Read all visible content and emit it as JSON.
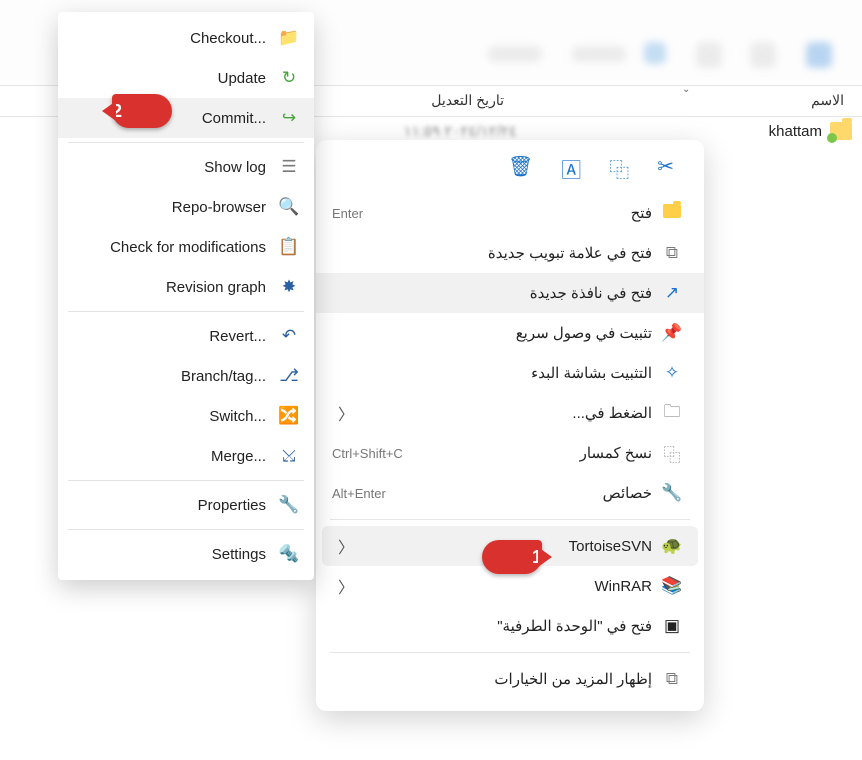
{
  "headers": {
    "name": "الاسم",
    "date": "تاريخ التعديل"
  },
  "folder": {
    "name": "khattam",
    "datetime": "٢٠٢٤/١٢/٢٤ ١١:٥٩"
  },
  "badges": {
    "b1": "1",
    "b2": "2"
  },
  "ctx": {
    "open": {
      "label": "فتح",
      "shortcut": "Enter"
    },
    "open_tab": {
      "label": "فتح في علامة تبويب جديدة"
    },
    "open_win": {
      "label": "فتح في نافذة جديدة"
    },
    "pin_quick": {
      "label": "تثبيت في وصول سريع"
    },
    "pin_start": {
      "label": "التثبيت بشاشة البدء"
    },
    "compress": {
      "label": "الضغط في..."
    },
    "copy_path": {
      "label": "نسخ كمسار",
      "shortcut": "Ctrl+Shift+C"
    },
    "properties": {
      "label": "خصائص",
      "shortcut": "Alt+Enter"
    },
    "tortoisesvn": {
      "label": "TortoiseSVN"
    },
    "winrar": {
      "label": "WinRAR"
    },
    "terminal": {
      "label": "فتح في \"الوحدة الطرفية\""
    },
    "more": {
      "label": "إظهار المزيد من الخيارات"
    }
  },
  "svn": {
    "checkout": {
      "label": "Checkout..."
    },
    "update": {
      "label": "Update"
    },
    "commit": {
      "label": "Commit..."
    },
    "showlog": {
      "label": "Show log"
    },
    "repobrowser": {
      "label": "Repo-browser"
    },
    "checkmods": {
      "label": "Check for modifications"
    },
    "revgraph": {
      "label": "Revision graph"
    },
    "revert": {
      "label": "Revert..."
    },
    "branchtag": {
      "label": "Branch/tag..."
    },
    "switch": {
      "label": "Switch..."
    },
    "merge": {
      "label": "Merge..."
    },
    "properties": {
      "label": "Properties"
    },
    "settings": {
      "label": "Settings"
    }
  }
}
